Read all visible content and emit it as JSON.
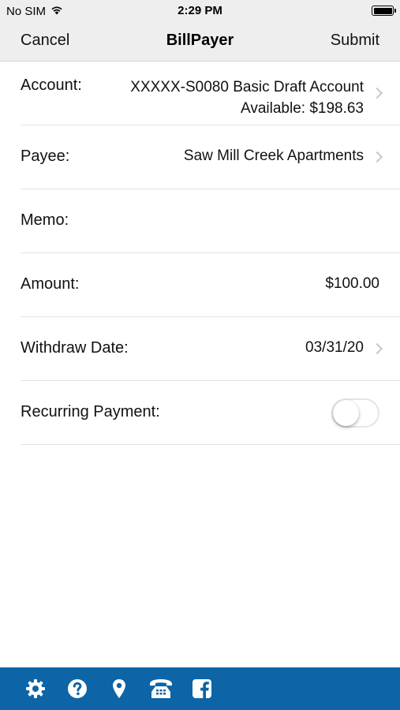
{
  "status_bar": {
    "carrier": "No SIM",
    "time": "2:29 PM"
  },
  "nav": {
    "cancel_label": "Cancel",
    "title": "BillPayer",
    "submit_label": "Submit"
  },
  "form": {
    "account": {
      "label": "Account:",
      "value_line1": "XXXXX-S0080 Basic Draft Account",
      "value_line2": "Available: $198.63"
    },
    "payee": {
      "label": "Payee:",
      "value": "Saw Mill Creek Apartments"
    },
    "memo": {
      "label": "Memo:",
      "value": ""
    },
    "amount": {
      "label": "Amount:",
      "value": "$100.00"
    },
    "withdraw_date": {
      "label": "Withdraw Date:",
      "value": "03/31/20"
    },
    "recurring": {
      "label": "Recurring Payment:",
      "enabled": false
    }
  },
  "tab_bar": {
    "background": "#0d64a6",
    "icons": [
      "gear-icon",
      "help-icon",
      "location-icon",
      "phone-icon",
      "facebook-icon"
    ]
  }
}
